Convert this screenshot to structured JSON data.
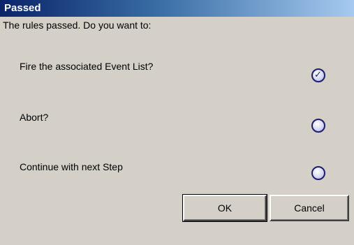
{
  "dialog": {
    "title": "Passed",
    "prompt": "The rules passed. Do you want to:",
    "options": [
      {
        "label": "Fire the associated Event List?",
        "checked": true,
        "check_glyph": "✓"
      },
      {
        "label": "Abort?",
        "checked": false
      },
      {
        "label": "Continue with next Step",
        "checked": false
      }
    ],
    "buttons": {
      "ok_label": "OK",
      "cancel_label": "Cancel"
    }
  },
  "colors": {
    "dialog_background": "#d4d0c8",
    "title_bar_start": "#0a246a",
    "title_bar_end": "#a6caf0",
    "radio_border": "#1d1d6a"
  },
  "icons": {
    "checked_radio": "radio-checked-icon",
    "unchecked_radio": "radio-unchecked-icon"
  }
}
